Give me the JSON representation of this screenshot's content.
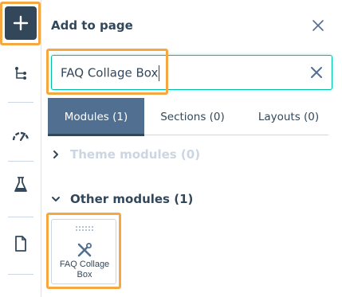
{
  "rail": {
    "items": [
      {
        "name": "add",
        "icon": "plus-icon"
      },
      {
        "name": "structure",
        "icon": "tree-icon"
      },
      {
        "name": "optimize",
        "icon": "gauge-icon"
      },
      {
        "name": "test",
        "icon": "flask-icon"
      },
      {
        "name": "page",
        "icon": "document-icon"
      }
    ]
  },
  "panel": {
    "title": "Add to page",
    "close_icon": "close-icon"
  },
  "search": {
    "value": "FAQ Collage Box",
    "clear_icon": "close-icon"
  },
  "tabs": [
    {
      "label": "Modules (1)",
      "active": true
    },
    {
      "label": "Sections (0)",
      "active": false
    },
    {
      "label": "Layouts (0)",
      "active": false
    }
  ],
  "groups": {
    "theme": {
      "label": "Theme modules (0)",
      "expanded": false
    },
    "other": {
      "label": "Other modules (1)",
      "expanded": true
    }
  },
  "module_card": {
    "label": "FAQ Collage Box",
    "icon": "tools-icon",
    "grip_icon": "drag-handle-icon"
  },
  "colors": {
    "highlight": "#f5a742",
    "rail_active": "#33475b",
    "tab_active": "#516f90",
    "focus": "#00bda5",
    "muted": "#cbd6e2"
  }
}
